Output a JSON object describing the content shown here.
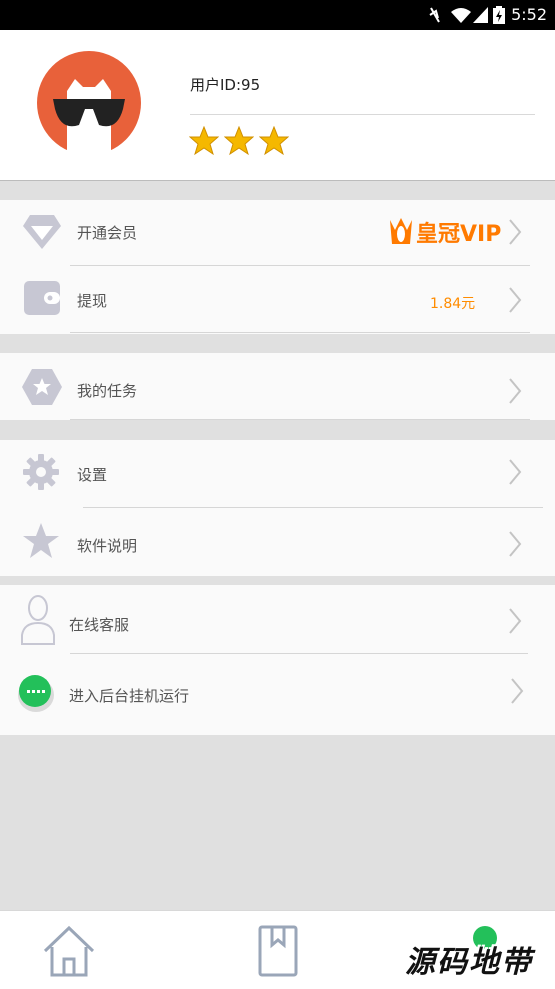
{
  "status_bar": {
    "time": "5:52"
  },
  "profile": {
    "user_id_label": "用户ID:95",
    "star_count": 3
  },
  "menu": {
    "vip": {
      "label": "开通会员",
      "badge": "皇冠VIP"
    },
    "withdraw": {
      "label": "提现",
      "amount": "1.84元"
    },
    "tasks": {
      "label": "我的任务"
    },
    "settings": {
      "label": "设置"
    },
    "software_info": {
      "label": "软件说明"
    },
    "customer_service": {
      "label": "在线客服"
    },
    "background_run": {
      "label": "进入后台挂机运行"
    }
  },
  "bottom_nav": {
    "items": [
      "home-icon",
      "bookmark-icon",
      "profile-dot"
    ]
  },
  "watermark": "源码地带",
  "colors": {
    "accent_orange": "#ff7a00",
    "avatar_bg": "#e8613a",
    "status_green": "#23c05a",
    "icon_gray": "#b7b7c6"
  }
}
